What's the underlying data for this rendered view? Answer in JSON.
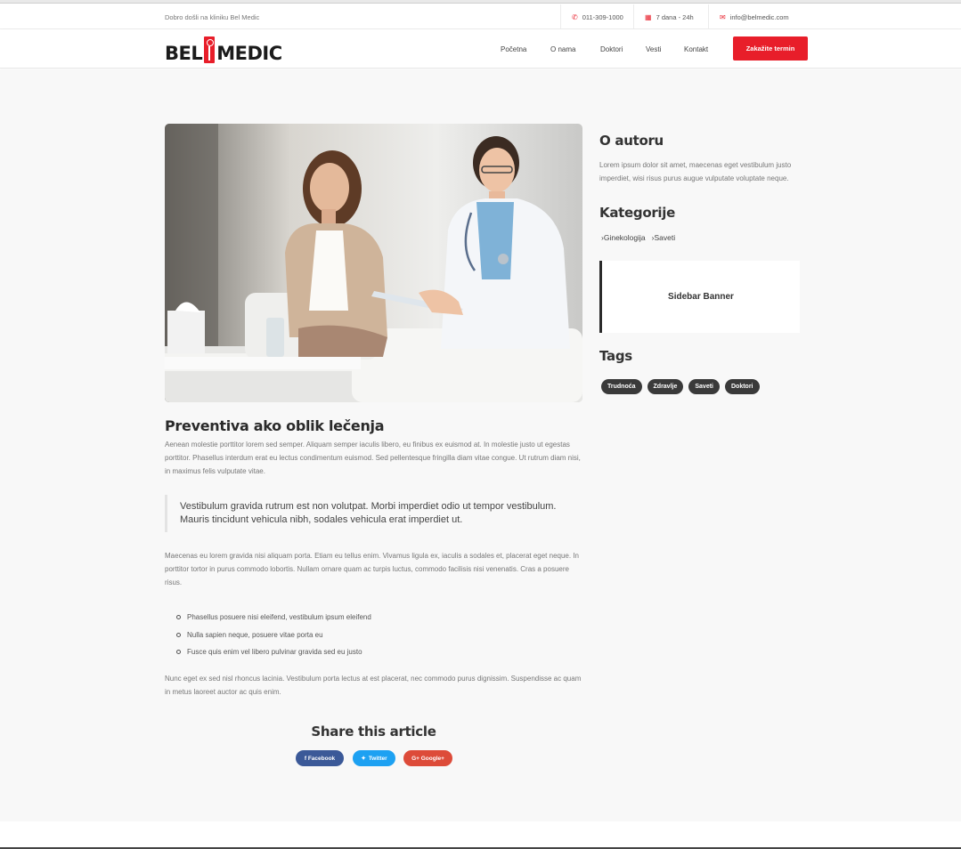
{
  "topbar": {
    "welcome": "Dobro došli na kliniku Bel Medic",
    "phone": "011-309-1000",
    "hours": "7 dana - 24h",
    "email": "info@belmedic.com"
  },
  "header": {
    "logo_left": "BEL",
    "logo_right": "MEDIC",
    "nav": [
      "Početna",
      "O nama",
      "Doktori",
      "Vesti",
      "Kontakt"
    ],
    "cta": "Zakažite termin"
  },
  "article": {
    "title": "Preventiva ako oblik lečenja",
    "p1": "Aenean molestie porttitor lorem sed semper. Aliquam semper iaculis libero, eu finibus ex euismod at. In molestie justo ut egestas porttitor. Phasellus interdum erat eu lectus condimentum euismod. Sed pellentesque fringilla diam vitae congue. Ut rutrum diam nisi, in maximus felis vulputate vitae.",
    "quote": "Vestibulum gravida rutrum est non volutpat. Morbi imperdiet odio ut tempor vestibulum. Mauris tincidunt vehicula nibh, sodales vehicula erat imperdiet ut.",
    "p2": "Maecenas eu lorem gravida nisi aliquam porta. Etiam eu tellus enim. Vivamus ligula ex, iaculis a sodales et, placerat eget neque. In porttitor tortor in purus commodo lobortis. Nullam ornare quam ac turpis luctus, commodo facilisis nisi venenatis. Cras a posuere risus.",
    "list": [
      "Phasellus posuere nisi eleifend, vestibulum ipsum eleifend",
      "Nulla sapien neque, posuere vitae porta eu",
      "Fusce quis enim vel libero pulvinar gravida sed eu justo"
    ],
    "p3": "Nunc eget ex sed nisl rhoncus lacinia. Vestibulum porta lectus at est placerat, nec commodo purus dignissim. Suspendisse ac quam in metus laoreet auctor ac quis enim."
  },
  "share": {
    "title": "Share this article",
    "facebook": "f Facebook",
    "twitter": "Twitter",
    "google": "G+ Google+"
  },
  "sidebar": {
    "about_title": "O autoru",
    "about_text": "Lorem ipsum dolor sit amet, maecenas eget vestibulum justo imperdiet, wisi risus purus augue vulputate voluptate neque.",
    "categories_title": "Kategorije",
    "categories": [
      "Ginekologija",
      "Saveti"
    ],
    "banner": "Sidebar Banner",
    "tags_title": "Tags",
    "tags": [
      "Trudnoća",
      "Zdravlje",
      "Saveti",
      "Doktori"
    ]
  },
  "colors": {
    "accent": "#e81e2a",
    "facebook": "#3b5998",
    "twitter": "#1da1f2",
    "google": "#dd4b39"
  }
}
